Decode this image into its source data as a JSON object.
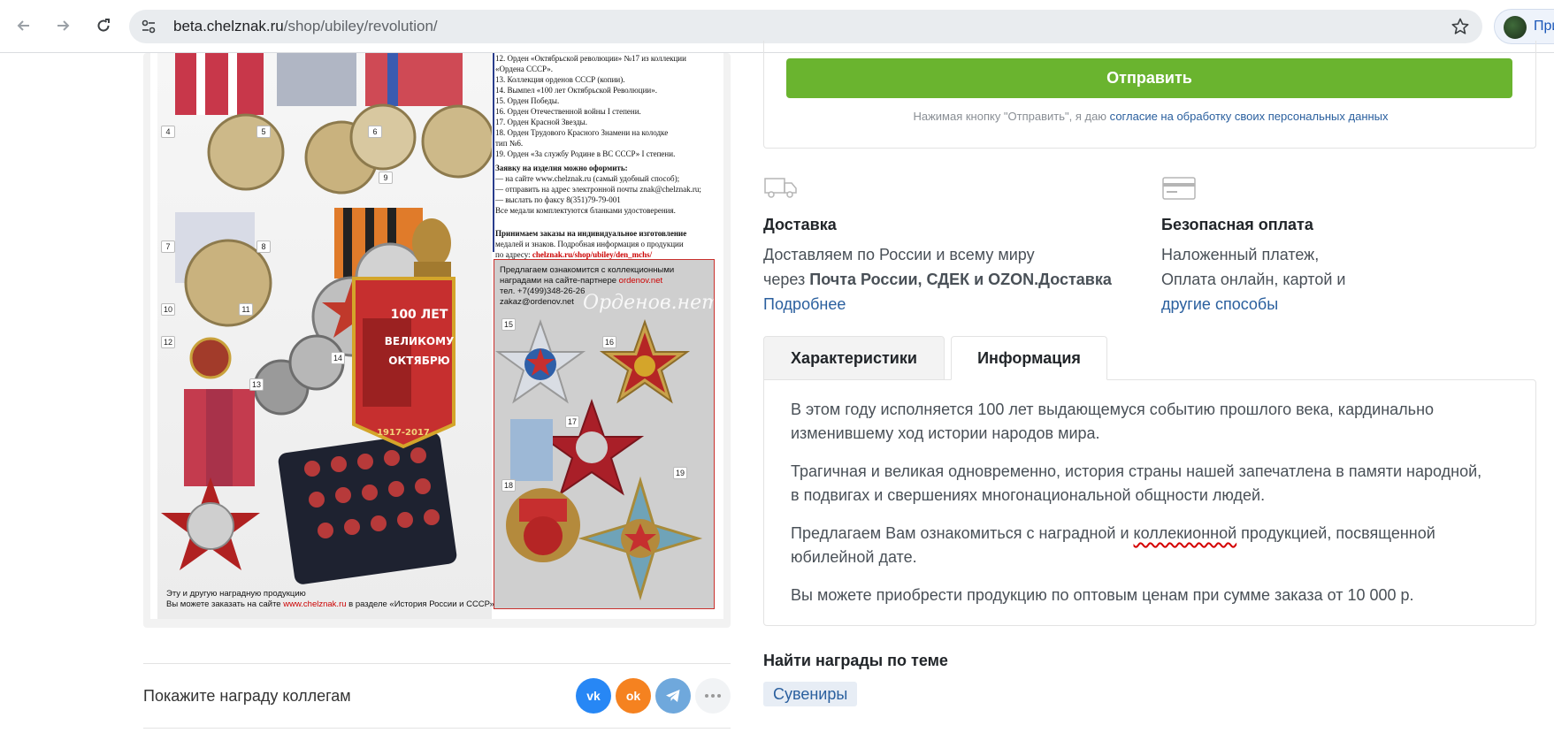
{
  "browser": {
    "url_host": "beta.chelznak.ru",
    "url_path": "/shop/ubiley/revolution/",
    "profile_label": "При"
  },
  "poster": {
    "list_lines": [
      "12. Орден «Октябрьской революции» №17 из коллекции",
      "      «Ордена СССР».",
      "13. Коллекция орденов СССР (копии).",
      "14. Вымпел «100 лет Октябрьской Революции».",
      "15. Орден Победы.",
      "16. Орден Отечественной войны I степени.",
      "17. Орден Красной Звезды.",
      "18. Орден Трудового Красного Знамени на колодке",
      "      тип №6.",
      "19. Орден «За службу Родине в ВС СССР» I степени."
    ],
    "order_title": "Заявку на изделия можно оформить:",
    "order_lines": [
      "— на сайте www.chelznak.ru (самый удобный способ);",
      "— отправить на адрес электронной почты znak@chelznak.ru;",
      "— выслать по факсу 8(351)79-79-001",
      "Все медали комплектуются бланками удостоверения."
    ],
    "custom_title": "Принимаем заказы на индивидуальное изготовление",
    "custom_lines": [
      "медалей и знаков. Подробная информация о продукции",
      "по адресу:"
    ],
    "custom_link": "chelznak.ru/shop/ubiley/den_mchs/",
    "partner_line1": "Предлагаем ознакомится с коллекционными",
    "partner_line2a": "наградами на сайте-партнере ",
    "partner_link": "ordenov.net",
    "partner_phone": "тел. +7(499)348-26-26",
    "partner_email": "zakaz@ordenov.net",
    "watermark": "Орденов.нет",
    "pennant_text": "100 ЛЕТ ВЕЛИКОМУ ОКТЯБРЮ",
    "pennant_years": "1917-2017",
    "caption_line1": "Эту и другую наградную продукцию",
    "caption_line2a": "Вы можете заказать на сайте ",
    "caption_link": "www.chelznak.ru",
    "caption_line2b": " в разделе «История России и СССР»",
    "numbers": [
      "4",
      "5",
      "6",
      "7",
      "8",
      "9",
      "10",
      "11",
      "12",
      "13",
      "14",
      "15",
      "16",
      "17",
      "18",
      "19"
    ]
  },
  "share": {
    "label": "Покажите награду коллегам",
    "vk": "vk",
    "ok": "ok"
  },
  "form": {
    "submit_label": "Отправить",
    "consent_prefix": "Нажимая кнопку \"Отправить\", я даю ",
    "consent_link": "согласие на обработку своих персональных данных"
  },
  "delivery": {
    "title": "Доставка",
    "line1": "Доставляем по России и всему миру",
    "line2_prefix": "через ",
    "line2_bold": "Почта России, СДЕК и OZON.Доставка",
    "more_link": "Подробнее"
  },
  "payment": {
    "title": "Безопасная оплата",
    "line1": "Наложенный платеж,",
    "line2": "Оплата онлайн, картой и",
    "more_link": "другие способы"
  },
  "tabs": [
    {
      "label": "Характеристики",
      "active": false
    },
    {
      "label": "Информация",
      "active": true
    }
  ],
  "info": {
    "p1_line1": "В этом году исполняется 100 лет выдающемуся событию прошлого века, кардинально",
    "p1_line2": "изменившему ход истории народов мира.",
    "p2_line1": "Трагичная и великая одновременно, история страны нашей запечатлена в памяти народной,",
    "p2_line2": "в подвигах и свершениях многонациональной общности людей.",
    "p3_before": "Предлагаем Вам ознакомиться с наградной и ",
    "p3_squiggle": "коллекионной",
    "p3_after": " продукцией, посвященной",
    "p3_line2": "юбилейной дате.",
    "p4": "Вы можете приобрести продукцию по оптовым ценам при сумме заказа от 10 000 р."
  },
  "topics": {
    "title": "Найти награды по теме",
    "tags": [
      "Сувениры"
    ]
  },
  "colors": {
    "accent_green": "#6ab42f",
    "link_blue": "#2a5f9e",
    "vk": "#2787f5",
    "ok": "#f58220",
    "telegram": "#6fa8dc"
  }
}
